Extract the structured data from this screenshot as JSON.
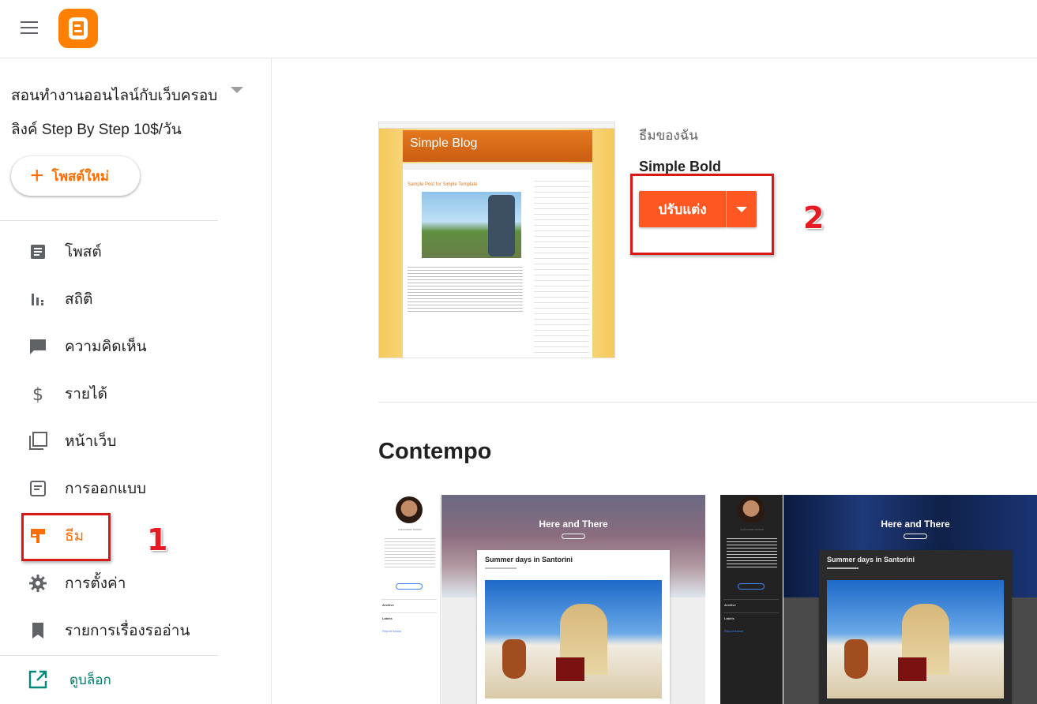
{
  "header": {
    "menu_icon": "hamburger-menu-icon",
    "logo_icon": "blogger-logo-icon",
    "brand_color": "#ff8000"
  },
  "sidebar": {
    "blog_title_line1": "สอนทำงานออนไลน์กับเว็บครอบ",
    "blog_title_line2": "ลิงค์ Step By Step 10$/วัน",
    "new_post_label": "โพสต์ใหม่",
    "items": [
      {
        "label": "โพสต์",
        "icon": "posts-icon"
      },
      {
        "label": "สถิติ",
        "icon": "stats-icon"
      },
      {
        "label": "ความคิดเห็น",
        "icon": "comments-icon"
      },
      {
        "label": "รายได้",
        "icon": "earnings-icon"
      },
      {
        "label": "หน้าเว็บ",
        "icon": "pages-icon"
      },
      {
        "label": "การออกแบบ",
        "icon": "layout-icon"
      },
      {
        "label": "ธีม",
        "icon": "theme-icon",
        "active": true
      },
      {
        "label": "การตั้งค่า",
        "icon": "settings-icon"
      },
      {
        "label": "รายการเรื่องรออ่าน",
        "icon": "reading-list-icon"
      }
    ],
    "view_blog_label": "ดูบล็อก"
  },
  "annotations": {
    "step1": "1",
    "step2": "2",
    "color": "#e51c23"
  },
  "main": {
    "current_theme": {
      "preview_header": "Simple Blog",
      "preview_post_title": "Sample Post for Simple Template",
      "label": "ธีมของฉัน",
      "name": "Simple Bold",
      "customize_label": "ปรับแต่ง",
      "accent_color": "#ff5722"
    },
    "section_title": "Contempo",
    "cards": [
      {
        "heading": "Here and There",
        "post_title": "Summer days in Santorini",
        "author": "ALEXANDRA NOWAK",
        "labels": [
          "Archive",
          "Labels"
        ],
        "report": "Report Abuse"
      },
      {
        "heading": "Here and There",
        "post_title": "Summer days in Santorini",
        "author": "ALEXANDRA NOWAK",
        "labels": [
          "Archive",
          "Labels"
        ],
        "report": "Report Abuse"
      }
    ]
  }
}
